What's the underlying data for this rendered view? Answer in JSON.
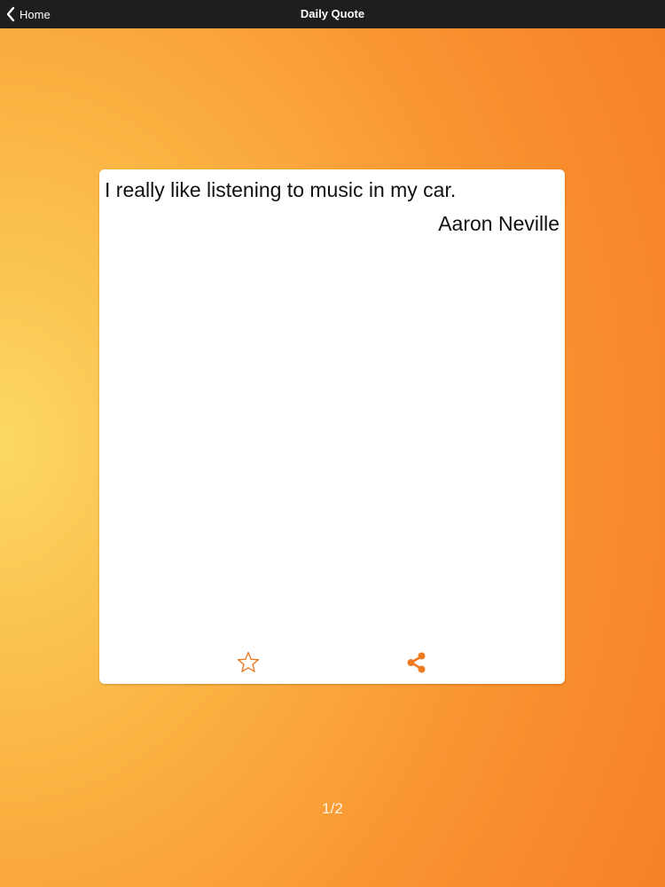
{
  "navbar": {
    "back_label": "Home",
    "title": "Daily Quote",
    "background": "#1e1e20"
  },
  "quote": {
    "text": "I really like listening to music in my car.",
    "author": "Aaron Neville"
  },
  "actions": {
    "favorite_icon": "star-outline-icon",
    "share_icon": "share-icon",
    "accent_color": "#f07a22"
  },
  "pager": {
    "indicator": "1/2"
  },
  "theme": {
    "gradient_light": "#fbd862",
    "gradient_dark": "#f67c24"
  }
}
